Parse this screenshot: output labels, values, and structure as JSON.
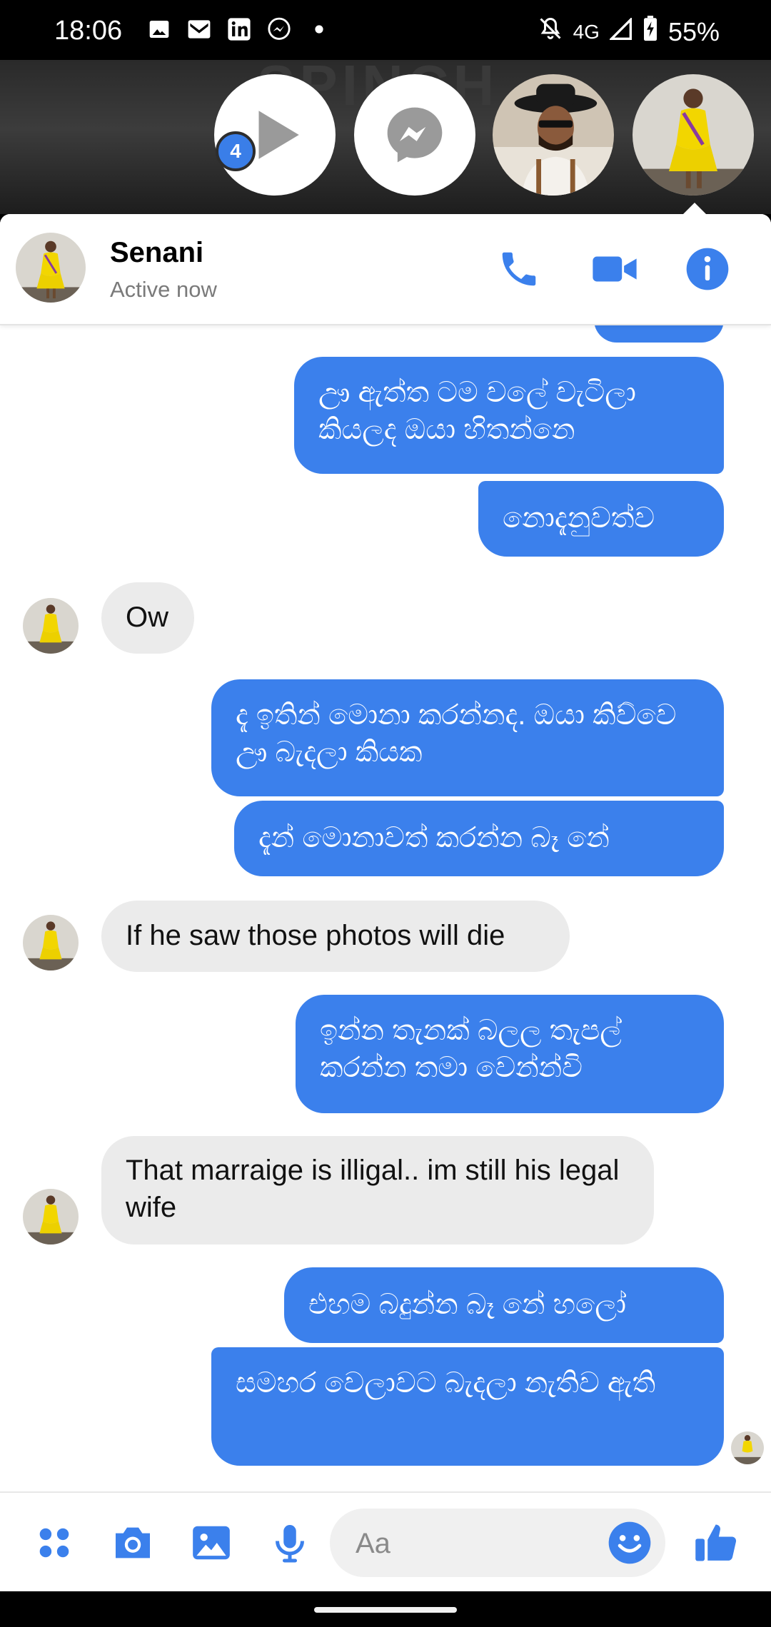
{
  "status_bar": {
    "time": "18:06",
    "left_icons": [
      "image-icon",
      "gmail-icon",
      "linkedin-icon",
      "messenger-icon",
      "dot-icon"
    ],
    "network": "4G",
    "battery": "55%",
    "right_icons": [
      "mute-icon",
      "signal-icon",
      "battery-charging-icon"
    ]
  },
  "chat_heads": {
    "banner_text": "SPINCH",
    "badge_count": "4",
    "items": [
      "play-icon",
      "messenger-icon",
      "contact-avatar-man",
      "contact-avatar-senani"
    ]
  },
  "header": {
    "name": "Senani",
    "status": "Active now",
    "actions": [
      "phone-icon",
      "video-icon",
      "info-icon"
    ],
    "accent": "#3b80ec"
  },
  "messages": [
    {
      "dir": "out",
      "text": "ඌ ඇත්ත ටම වලේ වැටිලා කියලද ඔයා හිතන්නෙ"
    },
    {
      "dir": "out",
      "text": "නොදැනුවත්ව"
    },
    {
      "dir": "in",
      "text": "Ow"
    },
    {
      "dir": "out",
      "text": "දැ ඉතින් මොනා කරන්නද. ඔයා කිව්වෙ ඌ බැදලා කියක"
    },
    {
      "dir": "out",
      "text": "දැන් මොනාවත් කරන්න බෑ නේ"
    },
    {
      "dir": "in",
      "text": "If he saw those photos will die"
    },
    {
      "dir": "out",
      "text": "ඉන්න තැනක් බලල තැපල් කරන්න තමා වෙන්න්වි"
    },
    {
      "dir": "in",
      "text": "That marraige is illigal.. im still his legal wife"
    },
    {
      "dir": "out",
      "text": "එහම බදුන්න බෑ නේ හලෝ"
    },
    {
      "dir": "out",
      "text": "සමහර වෙලාවට බැදලා නැතිව ඇති"
    }
  ],
  "composer": {
    "placeholder": "Aa",
    "left_buttons": [
      "apps-grid-icon",
      "camera-icon",
      "gallery-icon",
      "microphone-icon"
    ],
    "emoji": "smiley-icon",
    "send": "thumbs-up-icon"
  }
}
